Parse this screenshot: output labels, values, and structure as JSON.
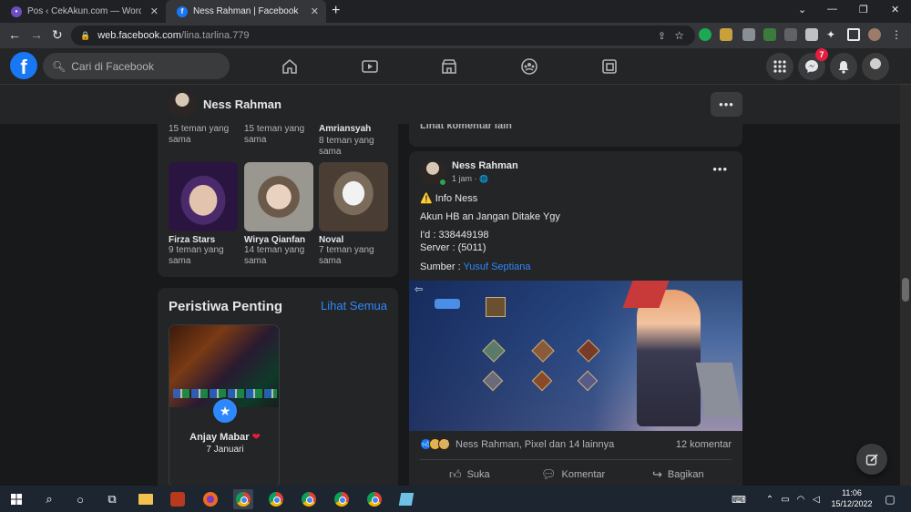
{
  "browser": {
    "tabs": [
      {
        "title": "Pos ‹ CekAkun.com — WordPress",
        "active": false
      },
      {
        "title": "Ness Rahman | Facebook",
        "active": true
      }
    ],
    "url_host": "web.facebook.com",
    "url_path": "/lina.tarlina.779"
  },
  "facebook": {
    "search_placeholder": "Cari di Facebook",
    "notifications_badge": "7",
    "nav_icons": [
      "home-icon",
      "watch-icon",
      "marketplace-icon",
      "groups-icon",
      "gaming-icon"
    ]
  },
  "profile_bar": {
    "name": "Ness Rahman",
    "more": "•••"
  },
  "friends": {
    "top_row": [
      {
        "mutual": "15 teman yang sama"
      },
      {
        "mutual": "15 teman yang sama"
      },
      {
        "name": "Amriansyah",
        "mutual": "8 teman yang sama"
      }
    ],
    "items": [
      {
        "name": "Firza Stars",
        "mutual": "9 teman yang sama"
      },
      {
        "name": "Wirya Qianfan",
        "mutual": "14 teman yang sama"
      },
      {
        "name": "Noval",
        "mutual": "7 teman yang sama"
      }
    ]
  },
  "events": {
    "title": "Peristiwa Penting",
    "see_all": "Lihat Semua",
    "event": {
      "name": "Anjay Mabar",
      "date": "7 Januari",
      "heart": "❤"
    }
  },
  "comments_prev": "Lihat komentar lain",
  "post": {
    "author": "Ness Rahman",
    "time": "1 jam · ",
    "globe": "🌐",
    "more": "•••",
    "line1": "⚠️ Info Ness",
    "line2": "Akun HB an Jangan Ditake Ygy",
    "line3": "I'd : 338449198",
    "line4": "Server : (5011)",
    "source_label": "Sumber : ",
    "source_link": "Yusuf Septiana",
    "reactions_text": "Ness Rahman, Pixel dan 14 lainnya",
    "comments": "12 komentar",
    "actions": {
      "like": "Suka",
      "comment": "Komentar",
      "share": "Bagikan"
    }
  },
  "taskbar": {
    "time": "11:06",
    "date": "15/12/2022"
  }
}
